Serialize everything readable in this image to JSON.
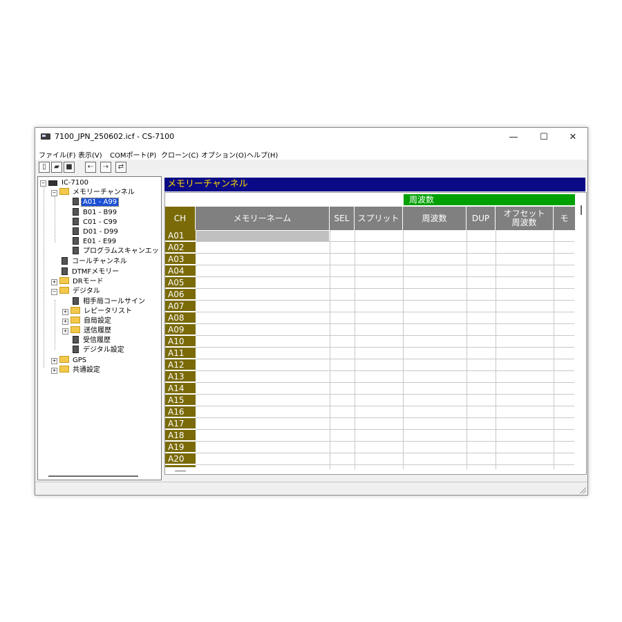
{
  "window": {
    "title": "7100_JPN_250602.icf - CS-7100",
    "controls": {
      "minimize": "—",
      "maximize": "☐",
      "close": "✕"
    }
  },
  "menu": [
    {
      "label": "ファイル(F)"
    },
    {
      "label": "表示(V)"
    },
    {
      "label": "COMポート(P)"
    },
    {
      "label": "クローン(C)"
    },
    {
      "label": "オプション(O)"
    },
    {
      "label": "ヘルプ(H)"
    }
  ],
  "toolbar": [
    {
      "icon": "new-file-icon",
      "glyph": "▯"
    },
    {
      "icon": "open-folder-icon",
      "glyph": "▰"
    },
    {
      "icon": "save-icon",
      "glyph": "■"
    },
    {
      "icon": "read-from-radio-icon",
      "glyph": "⇠"
    },
    {
      "icon": "write-to-radio-icon",
      "glyph": "⇢"
    },
    {
      "icon": "clone-icon",
      "glyph": "⇄"
    }
  ],
  "tree": [
    {
      "label": "IC-7100",
      "type": "radio",
      "level": 0,
      "toggle": "−"
    },
    {
      "label": "メモリーチャンネル",
      "type": "folder",
      "level": 1,
      "toggle": "−"
    },
    {
      "label": "A01 - A99",
      "type": "doc",
      "level": 2,
      "selected": true
    },
    {
      "label": "B01 - B99",
      "type": "doc",
      "level": 2
    },
    {
      "label": "C01 - C99",
      "type": "doc",
      "level": 2
    },
    {
      "label": "D01 - D99",
      "type": "doc",
      "level": 2
    },
    {
      "label": "E01 - E99",
      "type": "doc",
      "level": 2
    },
    {
      "label": "プログラムスキャンエッジ",
      "type": "doc",
      "level": 2
    },
    {
      "label": "コールチャンネル",
      "type": "doc",
      "level": 1
    },
    {
      "label": "DTMFメモリー",
      "type": "doc",
      "level": 1
    },
    {
      "label": "DRモード",
      "type": "folder",
      "level": 1,
      "toggle": "+"
    },
    {
      "label": "デジタル",
      "type": "folder",
      "level": 1,
      "toggle": "−"
    },
    {
      "label": "相手局コールサイン",
      "type": "doc",
      "level": 2
    },
    {
      "label": "レピータリスト",
      "type": "folder",
      "level": 2,
      "toggle": "+"
    },
    {
      "label": "自局設定",
      "type": "folder",
      "level": 2,
      "toggle": "+"
    },
    {
      "label": "送信履歴",
      "type": "folder",
      "level": 2,
      "toggle": "+"
    },
    {
      "label": "受信履歴",
      "type": "doc",
      "level": 2
    },
    {
      "label": "デジタル設定",
      "type": "doc",
      "level": 2
    },
    {
      "label": "GPS",
      "type": "folder",
      "level": 1,
      "toggle": "+"
    },
    {
      "label": "共通設定",
      "type": "folder",
      "level": 1,
      "toggle": "+"
    }
  ],
  "panel": {
    "title": "メモリーチャンネル",
    "group_header": "周波数",
    "columns": [
      {
        "key": "ch",
        "label": "CH"
      },
      {
        "key": "name",
        "label": "メモリーネーム"
      },
      {
        "key": "sel",
        "label": "SEL"
      },
      {
        "key": "split",
        "label": "スプリット"
      },
      {
        "key": "freq",
        "label": "周波数"
      },
      {
        "key": "dup",
        "label": "DUP"
      },
      {
        "key": "offset",
        "label": "オフセット\n周波数"
      },
      {
        "key": "mode",
        "label": "モ"
      }
    ],
    "rows": [
      "A01",
      "A02",
      "A03",
      "A04",
      "A05",
      "A06",
      "A07",
      "A08",
      "A09",
      "A10",
      "A11",
      "A12",
      "A13",
      "A14",
      "A15",
      "A16",
      "A17",
      "A18",
      "A19",
      "A20"
    ]
  },
  "colors": {
    "panel_title_bg": "#0a0a86",
    "panel_title_fg": "#ffd700",
    "freq_band_bg": "#00a000",
    "ch_cell_bg": "#7a6a08",
    "header_bg": "#808080",
    "selection": "#1a4fd6"
  }
}
